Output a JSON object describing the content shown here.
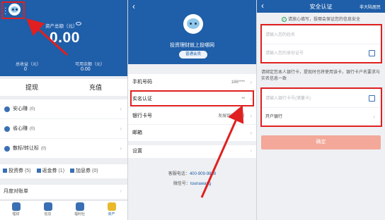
{
  "panel1": {
    "assets_label": "资产总额（元）",
    "total_assets": "0.00",
    "earnings_label": "总收益（元）",
    "earnings_value": "0",
    "balance_label": "可用余额（元）",
    "balance_value": "0.00",
    "withdraw_label": "提现",
    "recharge_label": "充值",
    "products": [
      {
        "label": "安心赚",
        "count": "(0)"
      },
      {
        "label": "省心赚",
        "count": "(0)"
      },
      {
        "label": "散标/转让标",
        "count": "(0)"
      }
    ],
    "coupons": [
      {
        "label": "投资券",
        "count": "(5)"
      },
      {
        "label": "返金券",
        "count": "(1)"
      },
      {
        "label": "加息券",
        "count": "(0)"
      }
    ],
    "monthly_bill": "月度对账单",
    "tabs": [
      {
        "label": "理财",
        "color": "#3a6fb3"
      },
      {
        "label": "信息",
        "color": "#3a6fb3"
      },
      {
        "label": "福利社",
        "color": "#3a6fb3"
      },
      {
        "label": "资产",
        "color": "#e9b92b"
      }
    ]
  },
  "panel2": {
    "slogan": "投资理财就上投哪网",
    "member_badge": "普通会员",
    "rows": [
      {
        "label": "手机号码",
        "value": "186****"
      },
      {
        "label": "实名认证",
        "value": "**"
      },
      {
        "label": "银行卡号",
        "value": "发展银行(尾号"
      },
      {
        "label": "邮箱",
        "value": ""
      }
    ],
    "settings_label": "设置",
    "service_label": "客服电话：",
    "service_phone": "400-909-9888",
    "wechat_label": "微信号：",
    "wechat_id": "tounawang"
  },
  "panel3": {
    "title": "安全认证",
    "region": "非大陆居民",
    "notice": "请放心填写，投哪会保证您的信息安全",
    "name_placeholder": "请输入您的姓名",
    "id_placeholder": "请输入您的身份证号",
    "hint": "请绑定您本人银行卡，提现时也将使用该卡，银行卡户名要求与实名信息一致",
    "card_placeholder": "请输入银行卡号(储蓄卡)",
    "bank_label": "开户银行",
    "confirm_label": "确定"
  },
  "colors": {
    "brand": "#1f5ea8",
    "highlight": "#e02020",
    "confirm": "#f3a899"
  }
}
